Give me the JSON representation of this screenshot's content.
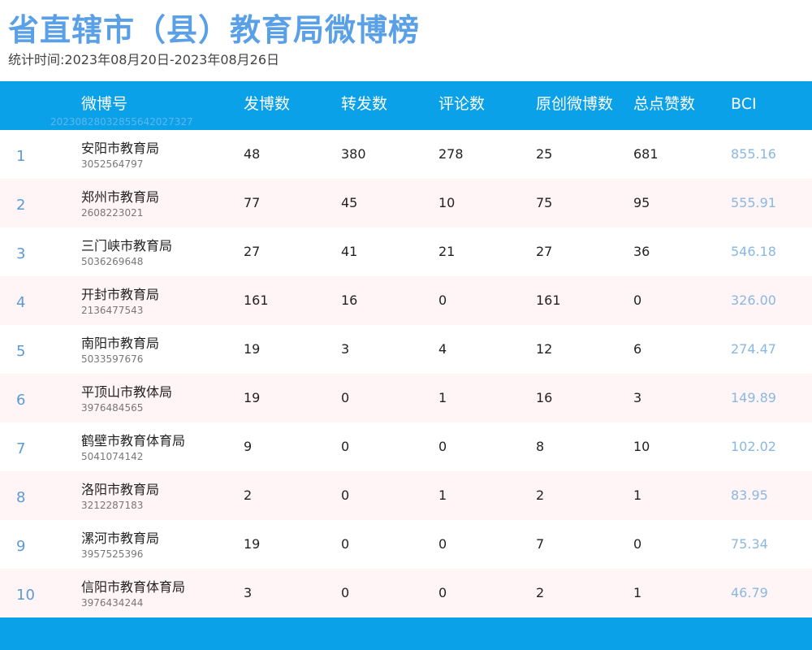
{
  "title": "省直辖市（县）教育局微博榜",
  "subtitle": "统计时间:2023年08月20日-2023年08月26日",
  "header": {
    "weibo": "微博号",
    "code": "20230828032855642027327",
    "posts": "发博数",
    "reposts": "转发数",
    "comments": "评论数",
    "original": "原创微博数",
    "likes": "总点赞数",
    "bci": "BCI"
  },
  "rows": [
    {
      "rank": "1",
      "name": "安阳市教育局",
      "id": "3052564797",
      "posts": "48",
      "reposts": "380",
      "comments": "278",
      "original": "25",
      "likes": "681",
      "bci": "855.16"
    },
    {
      "rank": "2",
      "name": "郑州市教育局",
      "id": "2608223021",
      "posts": "77",
      "reposts": "45",
      "comments": "10",
      "original": "75",
      "likes": "95",
      "bci": "555.91"
    },
    {
      "rank": "3",
      "name": "三门峡市教育局",
      "id": "5036269648",
      "posts": "27",
      "reposts": "41",
      "comments": "21",
      "original": "27",
      "likes": "36",
      "bci": "546.18"
    },
    {
      "rank": "4",
      "name": "开封市教育局",
      "id": "2136477543",
      "posts": "161",
      "reposts": "16",
      "comments": "0",
      "original": "161",
      "likes": "0",
      "bci": "326.00"
    },
    {
      "rank": "5",
      "name": "南阳市教育局",
      "id": "5033597676",
      "posts": "19",
      "reposts": "3",
      "comments": "4",
      "original": "12",
      "likes": "6",
      "bci": "274.47"
    },
    {
      "rank": "6",
      "name": "平顶山市教体局",
      "id": "3976484565",
      "posts": "19",
      "reposts": "0",
      "comments": "1",
      "original": "16",
      "likes": "3",
      "bci": "149.89"
    },
    {
      "rank": "7",
      "name": "鹤壁市教育体育局",
      "id": "5041074142",
      "posts": "9",
      "reposts": "0",
      "comments": "0",
      "original": "8",
      "likes": "10",
      "bci": "102.02"
    },
    {
      "rank": "8",
      "name": "洛阳市教育局",
      "id": "3212287183",
      "posts": "2",
      "reposts": "0",
      "comments": "1",
      "original": "2",
      "likes": "1",
      "bci": "83.95"
    },
    {
      "rank": "9",
      "name": "漯河市教育局",
      "id": "3957525396",
      "posts": "19",
      "reposts": "0",
      "comments": "0",
      "original": "7",
      "likes": "0",
      "bci": "75.34"
    },
    {
      "rank": "10",
      "name": "信阳市教育体育局",
      "id": "3976434244",
      "posts": "3",
      "reposts": "0",
      "comments": "0",
      "original": "2",
      "likes": "1",
      "bci": "46.79"
    }
  ],
  "colors": {
    "header_bg": "#0aa1e8",
    "title": "#5aa0e6",
    "rank": "#5b9bd5",
    "bci": "#8ab8e0",
    "alt_row": "#fff5f6"
  }
}
